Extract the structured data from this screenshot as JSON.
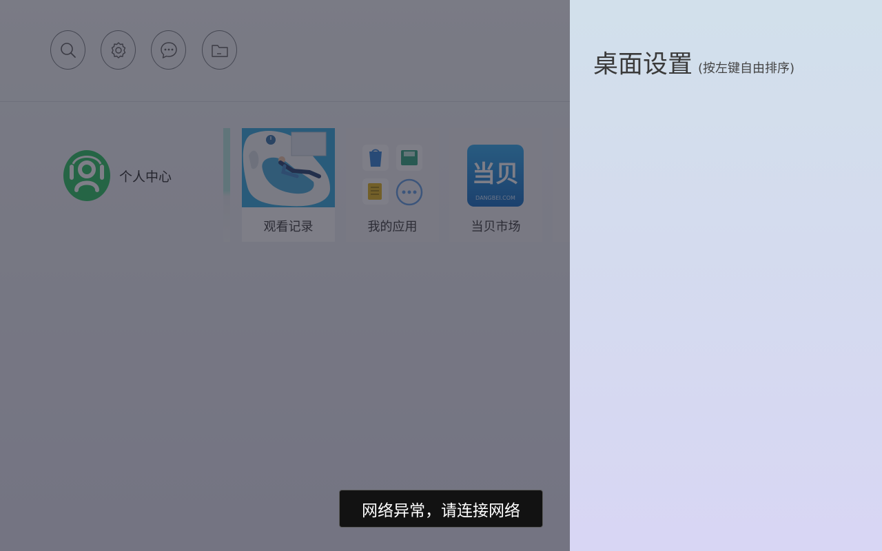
{
  "toolbar": {
    "buttons": [
      {
        "name": "search",
        "icon": "search-icon"
      },
      {
        "name": "settings",
        "icon": "gear-icon"
      },
      {
        "name": "messages",
        "icon": "chat-bubble-icon"
      },
      {
        "name": "files",
        "icon": "folder-icon"
      }
    ]
  },
  "profile": {
    "label": "个人中心",
    "icon": "person-headset-icon",
    "accent": "#22c05a"
  },
  "cards": [
    {
      "label": "观看记录",
      "icon": "relaxing-person-illustration"
    },
    {
      "label": "我的应用",
      "icon": "app-grid-icon"
    },
    {
      "label": "当贝市场",
      "icon": "dangbei-market-logo",
      "logo_text": "当贝",
      "logo_subtext": "DANGBEI.COM"
    }
  ],
  "toast": {
    "message": "网络异常，请连接网络"
  },
  "settings_panel": {
    "title": "桌面设置",
    "subtitle": "(按左键自由排序)"
  }
}
